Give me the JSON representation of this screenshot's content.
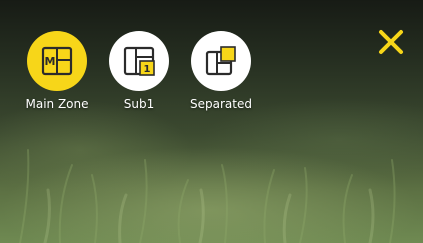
{
  "zones": {
    "items": [
      {
        "label": "Main Zone",
        "icon": "main-zone-icon",
        "badge": "M",
        "active": true
      },
      {
        "label": "Sub1",
        "icon": "sub-zone-icon",
        "badge": "1",
        "active": false
      },
      {
        "label": "Separated",
        "icon": "separated-zone-icon",
        "badge": "",
        "active": false
      }
    ]
  },
  "close": {
    "icon": "close-icon"
  },
  "colors": {
    "accent": "#f7d619",
    "icon_dark": "#2b2b2b",
    "label": "#ffffff"
  }
}
